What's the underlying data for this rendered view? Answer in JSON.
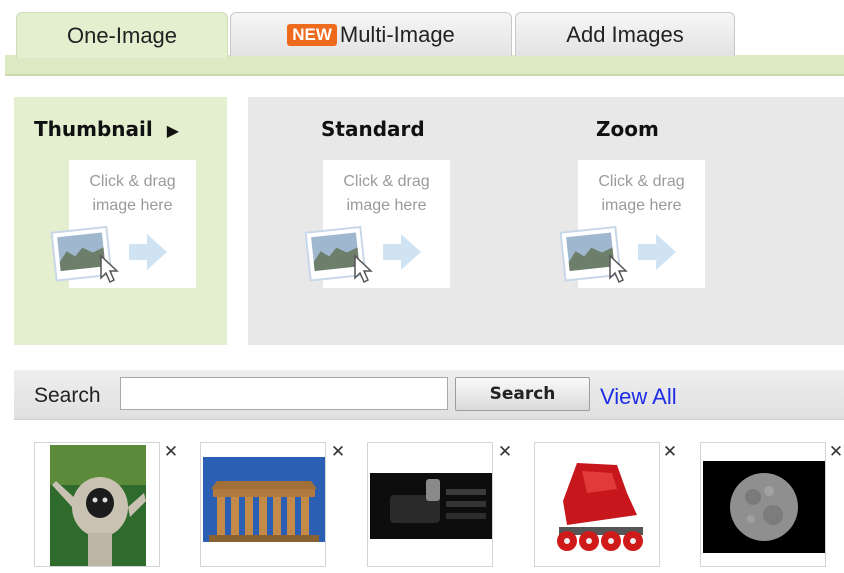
{
  "tabs": [
    {
      "label": "One-Image",
      "active": true
    },
    {
      "label": "Multi-Image",
      "badge": "NEW",
      "active": false
    },
    {
      "label": "Add Images",
      "active": false
    }
  ],
  "size_panel": {
    "thumbnail": {
      "title": "Thumbnail",
      "arrow": "▶",
      "drop_line1": "Click & drag",
      "drop_line2": "image here"
    },
    "standard": {
      "title": "Standard",
      "drop_line1": "Click & drag",
      "drop_line2": "image here"
    },
    "zoom": {
      "title": "Zoom",
      "drop_line1": "Click & drag",
      "drop_line2": "image here"
    }
  },
  "search": {
    "label": "Search",
    "value": "",
    "button_label": "Search",
    "view_all_label": "View All"
  },
  "images": [
    {
      "name": "gibbon-photo",
      "close": "✕"
    },
    {
      "name": "greek-temple-photo",
      "close": "✕"
    },
    {
      "name": "car-gear-shift-photo",
      "close": "✕"
    },
    {
      "name": "red-inline-skate-photo",
      "close": "✕"
    },
    {
      "name": "moon-photo",
      "close": "✕"
    }
  ],
  "colors": {
    "active_tab": "#e4efcf",
    "badge": "#ee6a1c",
    "link": "#1d2ce6",
    "panel_grey": "#e8e8e8"
  }
}
